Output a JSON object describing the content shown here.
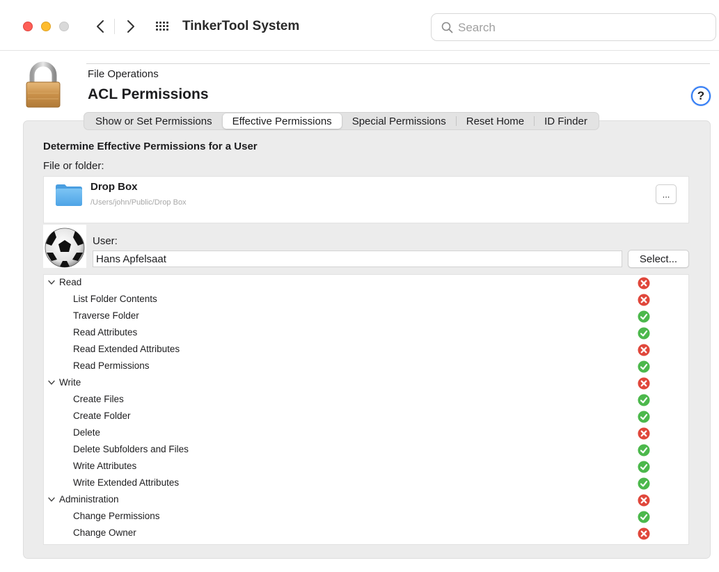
{
  "window": {
    "app_title": "TinkerTool System",
    "search_placeholder": "Search"
  },
  "header": {
    "category": "File Operations",
    "title": "ACL Permissions",
    "help_label": "?"
  },
  "tabs": [
    {
      "label": "Show or Set Permissions",
      "active": false
    },
    {
      "label": "Effective Permissions",
      "active": true
    },
    {
      "label": "Special Permissions",
      "active": false
    },
    {
      "label": "Reset Home",
      "active": false
    },
    {
      "label": "ID Finder",
      "active": false
    }
  ],
  "panel": {
    "section_heading": "Determine Effective Permissions for a User",
    "file_label": "File or folder:",
    "file": {
      "name": "Drop Box",
      "path": "/Users/john/Public/Drop Box",
      "browse_label": "..."
    },
    "user_label": "User:",
    "user_value": "Hans Apfelsaat",
    "select_label": "Select..."
  },
  "permissions": [
    {
      "label": "Read",
      "group": true,
      "granted": false
    },
    {
      "label": "List Folder Contents",
      "group": false,
      "granted": false
    },
    {
      "label": "Traverse Folder",
      "group": false,
      "granted": true
    },
    {
      "label": "Read Attributes",
      "group": false,
      "granted": true
    },
    {
      "label": "Read Extended Attributes",
      "group": false,
      "granted": false
    },
    {
      "label": "Read Permissions",
      "group": false,
      "granted": true
    },
    {
      "label": "Write",
      "group": true,
      "granted": false
    },
    {
      "label": "Create Files",
      "group": false,
      "granted": true
    },
    {
      "label": "Create Folder",
      "group": false,
      "granted": true
    },
    {
      "label": "Delete",
      "group": false,
      "granted": false
    },
    {
      "label": "Delete Subfolders and Files",
      "group": false,
      "granted": true
    },
    {
      "label": "Write Attributes",
      "group": false,
      "granted": true
    },
    {
      "label": "Write Extended Attributes",
      "group": false,
      "granted": true
    },
    {
      "label": "Administration",
      "group": true,
      "granted": false
    },
    {
      "label": "Change Permissions",
      "group": false,
      "granted": true
    },
    {
      "label": "Change Owner",
      "group": false,
      "granted": false
    }
  ],
  "colors": {
    "granted": "#4cb84c",
    "denied": "#e0473b",
    "accent": "#2f7bf5"
  }
}
